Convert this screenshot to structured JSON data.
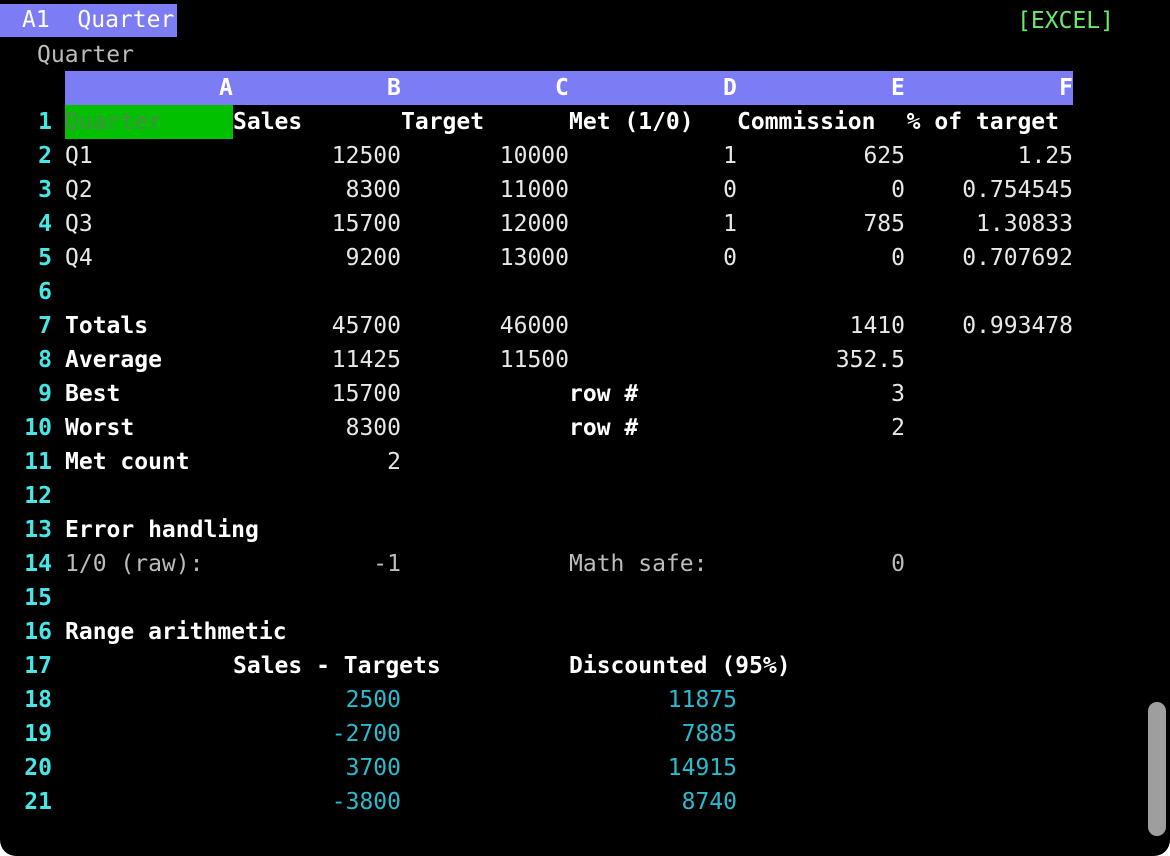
{
  "status": {
    "cell_ref": "A1  Quarter",
    "mode": "[EXCEL]"
  },
  "formula_bar": {
    "content": "Quarter"
  },
  "columns": [
    "A",
    "B",
    "C",
    "D",
    "E",
    "F"
  ],
  "rows": [
    {
      "num": "1",
      "cells": {
        "A": "Quarter",
        "B": "Sales",
        "C": "Target",
        "D": "Met (1/0)",
        "E": "Commission",
        "F": "% of target"
      }
    },
    {
      "num": "2",
      "cells": {
        "A": "Q1",
        "B": "12500",
        "C": "10000",
        "D": "1",
        "E": "625",
        "F": "1.25"
      }
    },
    {
      "num": "3",
      "cells": {
        "A": "Q2",
        "B": "8300",
        "C": "11000",
        "D": "0",
        "E": "0",
        "F": "0.754545"
      }
    },
    {
      "num": "4",
      "cells": {
        "A": "Q3",
        "B": "15700",
        "C": "12000",
        "D": "1",
        "E": "785",
        "F": "1.30833"
      }
    },
    {
      "num": "5",
      "cells": {
        "A": "Q4",
        "B": "9200",
        "C": "13000",
        "D": "0",
        "E": "0",
        "F": "0.707692"
      }
    },
    {
      "num": "6",
      "cells": {}
    },
    {
      "num": "7",
      "cells": {
        "A": "Totals",
        "B": "45700",
        "C": "46000",
        "E": "1410",
        "F": "0.993478"
      }
    },
    {
      "num": "8",
      "cells": {
        "A": "Average",
        "B": "11425",
        "C": "11500",
        "E": "352.5"
      }
    },
    {
      "num": "9",
      "cells": {
        "A": "Best",
        "B": "15700",
        "C2": "row #",
        "E": "3"
      }
    },
    {
      "num": "10",
      "cells": {
        "A": "Worst",
        "B": "8300",
        "C2": "row #",
        "E": "2"
      }
    },
    {
      "num": "11",
      "cells": {
        "A": "Met count",
        "B": "2"
      }
    },
    {
      "num": "12",
      "cells": {}
    },
    {
      "num": "13",
      "cells": {
        "A": "Error handling"
      }
    },
    {
      "num": "14",
      "cells": {
        "A": "1/0 (raw):",
        "B": "-1",
        "C2": "Math safe:",
        "E": "0"
      }
    },
    {
      "num": "15",
      "cells": {}
    },
    {
      "num": "16",
      "cells": {
        "A": "Range arithmetic"
      }
    },
    {
      "num": "17",
      "cells": {
        "B2": "Sales - Targets",
        "C2": "Discounted (95%)"
      }
    },
    {
      "num": "18",
      "cells": {
        "B": "2500",
        "D": "11875"
      }
    },
    {
      "num": "19",
      "cells": {
        "B": "-2700",
        "D": "7885"
      }
    },
    {
      "num": "20",
      "cells": {
        "B": "3700",
        "D": "14915"
      }
    },
    {
      "num": "21",
      "cells": {
        "B": "-3800",
        "D": "8740"
      }
    }
  ]
}
